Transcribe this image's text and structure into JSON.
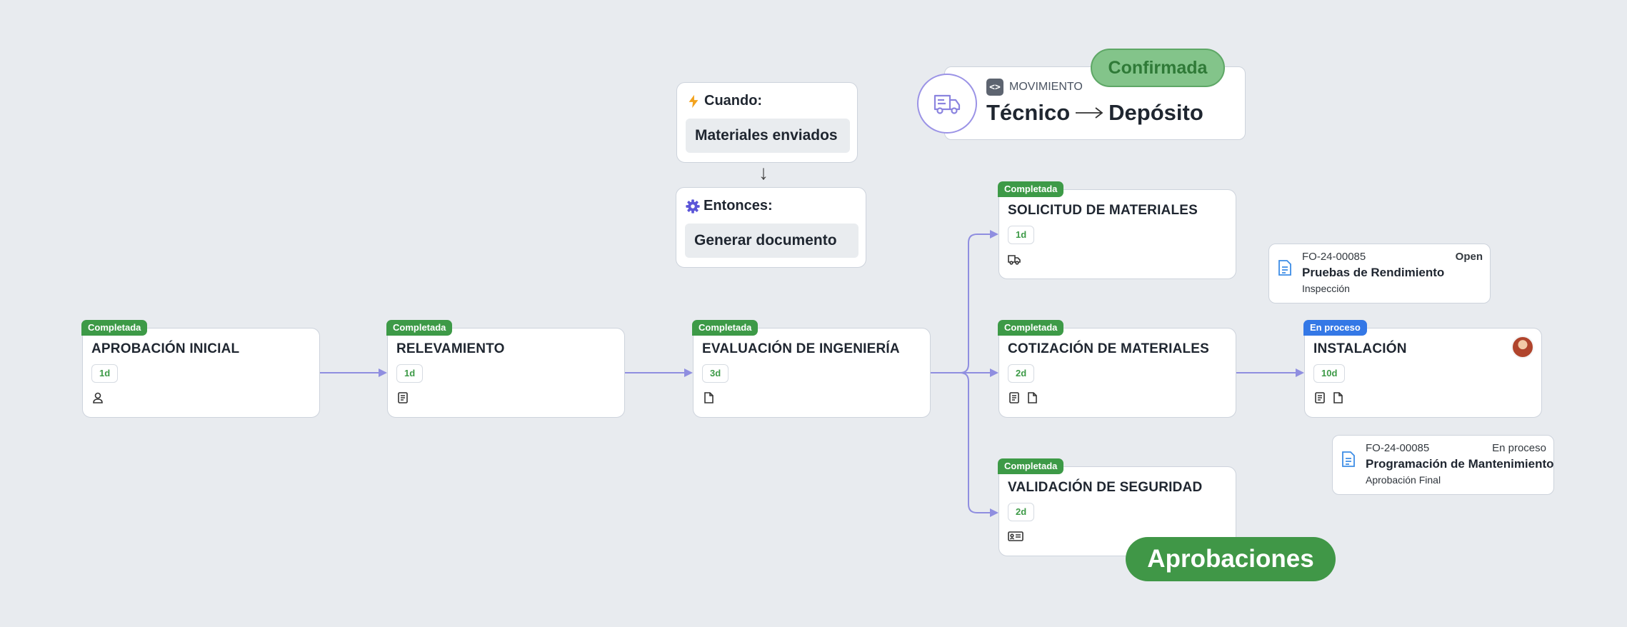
{
  "nodes": {
    "aprobacion": {
      "status": "Completada",
      "title": "APROBACIÓN INICIAL",
      "duration": "1d"
    },
    "relevamiento": {
      "status": "Completada",
      "title": "RELEVAMIENTO",
      "duration": "1d"
    },
    "evaluacion": {
      "status": "Completada",
      "title": "EVALUACIÓN DE INGENIERÍA",
      "duration": "3d"
    },
    "solicitud": {
      "status": "Completada",
      "title": "SOLICITUD DE MATERIALES",
      "duration": "1d"
    },
    "cotizacion": {
      "status": "Completada",
      "title": "COTIZACIÓN DE MATERIALES",
      "duration": "2d"
    },
    "validacion": {
      "status": "Completada",
      "title": "VALIDACIÓN DE SEGURIDAD",
      "duration": "2d"
    },
    "instalacion": {
      "status": "En proceso",
      "title": "INSTALACIÓN",
      "duration": "10d"
    }
  },
  "rule": {
    "when_label": "Cuando:",
    "when_value": "Materiales enviados",
    "then_label": "Entonces:",
    "then_value": "Generar documento"
  },
  "movement": {
    "label": "MOVIMIENTO",
    "from": "Técnico",
    "to": "Depósito",
    "status": "Confirmada"
  },
  "documents": [
    {
      "code": "FO-24-00085",
      "status": "Open",
      "title": "Pruebas de Rendimiento",
      "subtitle": "Inspección"
    },
    {
      "code": "FO-24-00085",
      "status": "En proceso",
      "title": "Programación de Mantenimiento",
      "subtitle": "Aprobación Final"
    }
  ],
  "approvals_label": "Aprobaciones",
  "colors": {
    "completed": "#3d9a47",
    "in_progress": "#3478e6",
    "edge": "#8f8ee0",
    "confirmed_bg": "#83c48a",
    "approvals_bg": "#409747"
  },
  "icons": [
    "lightning-icon",
    "gear-icon",
    "truck-icon",
    "code-icon",
    "user-badge-icon",
    "form-doc-icon",
    "file-icon",
    "id-card-icon",
    "document-icon",
    "avatar"
  ]
}
